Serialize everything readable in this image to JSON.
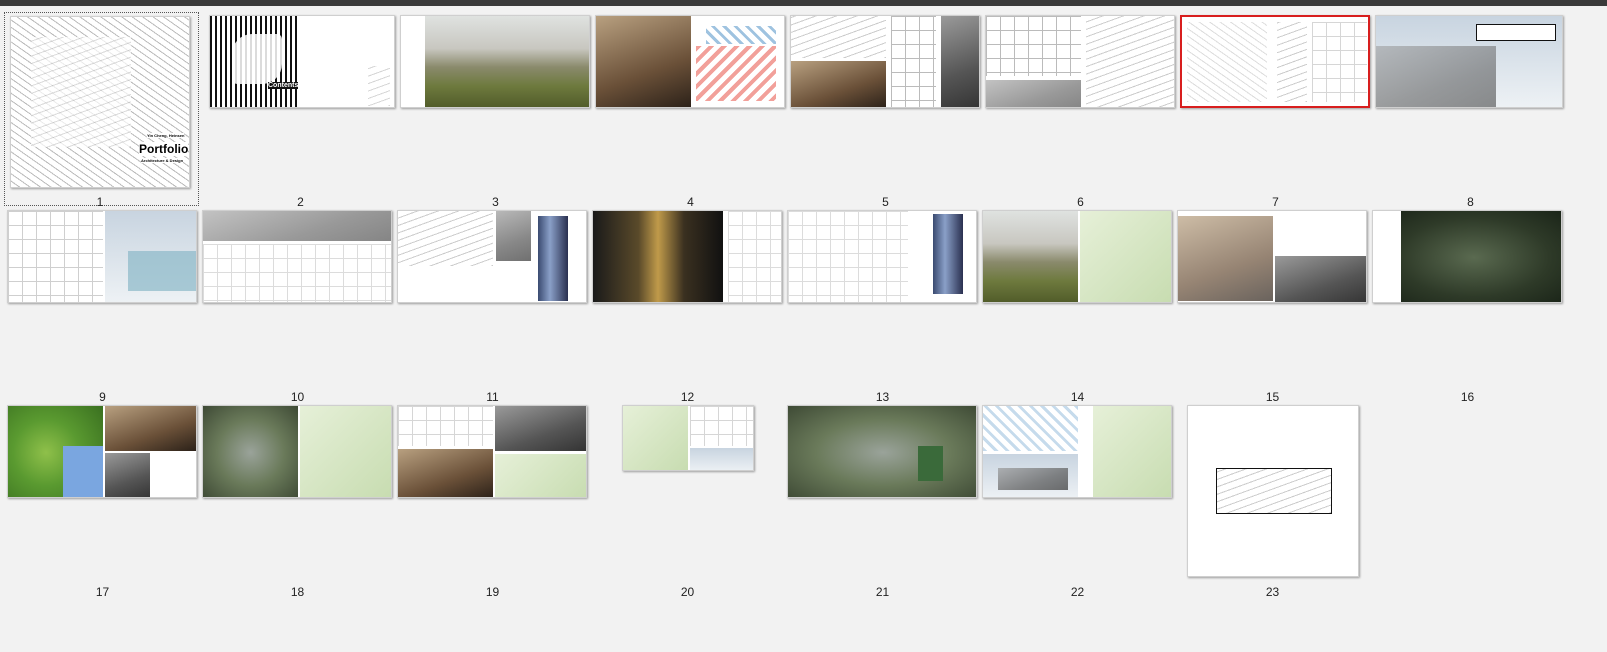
{
  "window": {
    "title": ""
  },
  "pages": [
    {
      "label": "1"
    },
    {
      "label": "2"
    },
    {
      "label": "3"
    },
    {
      "label": "4"
    },
    {
      "label": "5"
    },
    {
      "label": "6"
    },
    {
      "label": "7"
    },
    {
      "label": "8"
    },
    {
      "label": "9"
    },
    {
      "label": "10"
    },
    {
      "label": "11"
    },
    {
      "label": "12"
    },
    {
      "label": "13"
    },
    {
      "label": "14"
    },
    {
      "label": "15"
    },
    {
      "label": "16"
    },
    {
      "label": "17"
    },
    {
      "label": "18"
    },
    {
      "label": "19"
    },
    {
      "label": "20"
    },
    {
      "label": "21"
    },
    {
      "label": "22"
    },
    {
      "label": "23"
    }
  ],
  "page1": {
    "heading": "Portfolio",
    "subtitle": "Architecture & Design",
    "author": "Yin Cheng, Heinsen"
  },
  "page2": {
    "heading": "Contents"
  },
  "colors": {
    "selected_border": "#d81e1e",
    "background": "#f2f2f2",
    "topbar": "#3a3a3a"
  },
  "state": {
    "focused_page": "1",
    "selected_page": "7"
  }
}
